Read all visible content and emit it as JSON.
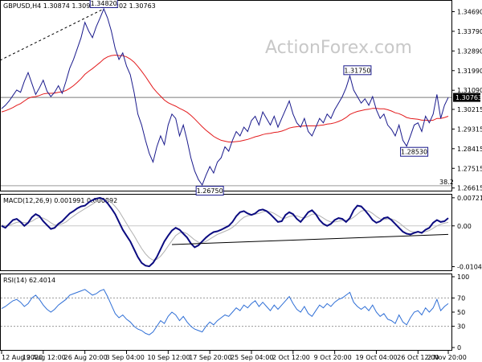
{
  "watermark": "ActionForex.com",
  "colors": {
    "price": "#1a1a8c",
    "ma": "#e31a1c",
    "macd_main": "#0b0b80",
    "macd_signal": "#b0b0b0",
    "rsi": "#2f6fd6",
    "ref_line": "#7a7a7a",
    "trend_line": "#000000",
    "frame": "#000000",
    "grid": "#cfcfcf"
  },
  "chart_data": [
    {
      "type": "line",
      "header": "GBPUSD,H4  1.30874 1.30957 1.30202 1.30763",
      "ylim": [
        1.2653,
        1.3515
      ],
      "yticks": [
        "1.34690",
        "1.33790",
        "1.32890",
        "1.31990",
        "1.31090",
        "1.30215",
        "1.29315",
        "1.28415",
        "1.27515",
        "1.26615"
      ],
      "current_price": "1.30763",
      "ref_level": 1.30763,
      "fib_label": "38.2",
      "fib_level": 1.2672,
      "annotations": [
        {
          "text": "1.34820",
          "x": 27,
          "y": 1.3482
        },
        {
          "text": "1.31750",
          "x": 94,
          "y": 1.3175
        },
        {
          "text": "1.26750",
          "x": 55,
          "y": 1.2675
        },
        {
          "text": "1.28530",
          "x": 109,
          "y": 1.2853
        }
      ],
      "series": [
        {
          "values": [
            1.3025,
            1.304,
            1.306,
            1.3085,
            1.311,
            1.31,
            1.315,
            1.319,
            1.314,
            1.309,
            1.312,
            1.3155,
            1.3105,
            1.308,
            1.31,
            1.313,
            1.3095,
            1.315,
            1.321,
            1.325,
            1.33,
            1.335,
            1.342,
            1.338,
            1.335,
            1.34,
            1.344,
            1.3482,
            1.344,
            1.338,
            1.33,
            1.325,
            1.328,
            1.322,
            1.318,
            1.31,
            1.3,
            1.295,
            1.288,
            1.282,
            1.278,
            1.285,
            1.29,
            1.286,
            1.295,
            1.3,
            1.298,
            1.29,
            1.295,
            1.288,
            1.28,
            1.274,
            1.27,
            1.2675,
            1.272,
            1.276,
            1.273,
            1.278,
            1.28,
            1.285,
            1.283,
            1.288,
            1.292,
            1.29,
            1.294,
            1.292,
            1.297,
            1.299,
            1.295,
            1.301,
            1.298,
            1.295,
            1.299,
            1.294,
            1.298,
            1.302,
            1.306,
            1.3,
            1.296,
            1.294,
            1.298,
            1.292,
            1.29,
            1.294,
            1.298,
            1.296,
            1.3,
            1.298,
            1.302,
            1.305,
            1.308,
            1.312,
            1.3175,
            1.311,
            1.308,
            1.305,
            1.307,
            1.304,
            1.308,
            1.302,
            1.298,
            1.3,
            1.295,
            1.293,
            1.29,
            1.295,
            1.288,
            1.2853,
            1.29,
            1.295,
            1.296,
            1.292,
            1.299,
            1.296,
            1.3,
            1.309,
            1.298,
            1.304,
            1.3076
          ]
        },
        {
          "values": [
            1.301,
            1.3015,
            1.3022,
            1.303,
            1.304,
            1.3048,
            1.306,
            1.3072,
            1.3078,
            1.308,
            1.3085,
            1.3092,
            1.3095,
            1.3095,
            1.3096,
            1.31,
            1.3102,
            1.3108,
            1.3118,
            1.313,
            1.3145,
            1.3162,
            1.3182,
            1.3196,
            1.3208,
            1.3222,
            1.3236,
            1.3252,
            1.3262,
            1.3268,
            1.327,
            1.3268,
            1.3268,
            1.3262,
            1.3252,
            1.3238,
            1.3218,
            1.3196,
            1.3172,
            1.3146,
            1.312,
            1.31,
            1.3082,
            1.3064,
            1.3052,
            1.3044,
            1.3036,
            1.3026,
            1.3018,
            1.3008,
            1.2994,
            1.2978,
            1.296,
            1.2942,
            1.2926,
            1.2912,
            1.2898,
            1.2888,
            1.288,
            1.2876,
            1.2872,
            1.2872,
            1.2874,
            1.2876,
            1.288,
            1.2884,
            1.289,
            1.2896,
            1.29,
            1.2906,
            1.291,
            1.2912,
            1.2916,
            1.2918,
            1.2922,
            1.2928,
            1.2936,
            1.294,
            1.2942,
            1.2944,
            1.2946,
            1.2946,
            1.2946,
            1.2946,
            1.2948,
            1.295,
            1.2954,
            1.2956,
            1.296,
            1.2966,
            1.2974,
            1.2984,
            1.2998,
            1.3006,
            1.3012,
            1.3016,
            1.302,
            1.3022,
            1.3026,
            1.3026,
            1.3024,
            1.3024,
            1.302,
            1.3014,
            1.3006,
            1.3002,
            1.2994,
            1.2984,
            1.298,
            1.2978,
            1.2976,
            1.2972,
            1.2972,
            1.297,
            1.2972,
            1.298,
            1.298,
            1.2984,
            1.299
          ]
        }
      ]
    },
    {
      "type": "line",
      "header": "MACD(12,26,9) 0.001991 0.000892",
      "ylim": [
        -0.0112,
        0.0078
      ],
      "yticks": [
        "0.007213",
        "0.00",
        "-0.01048"
      ],
      "ytick_values": [
        0.007213,
        0.0,
        -0.01048
      ],
      "zero_line": 0,
      "trendline": {
        "from": [
          45,
          -0.0048
        ],
        "to": [
          118,
          -0.0022
        ]
      },
      "series": [
        {
          "values": [
            0.0,
            -0.0005,
            0.0005,
            0.0015,
            0.0018,
            0.001,
            0.0,
            0.0008,
            0.0022,
            0.003,
            0.0025,
            0.0012,
            0.0002,
            -0.0008,
            -0.0005,
            0.0005,
            0.0012,
            0.0022,
            0.0032,
            0.0038,
            0.0045,
            0.005,
            0.0052,
            0.006,
            0.0066,
            0.007,
            0.0072,
            0.0068,
            0.0058,
            0.0045,
            0.003,
            0.001,
            -0.001,
            -0.0025,
            -0.004,
            -0.006,
            -0.008,
            -0.0095,
            -0.0102,
            -0.0104,
            -0.0095,
            -0.008,
            -0.006,
            -0.004,
            -0.0025,
            -0.0012,
            -0.0005,
            -0.001,
            -0.002,
            -0.003,
            -0.0045,
            -0.0055,
            -0.005,
            -0.004,
            -0.003,
            -0.0022,
            -0.0016,
            -0.0014,
            -0.001,
            -0.0005,
            0.0,
            0.001,
            0.0025,
            0.0035,
            0.0038,
            0.0032,
            0.0028,
            0.0032,
            0.004,
            0.0042,
            0.0038,
            0.003,
            0.002,
            0.001,
            0.0012,
            0.0028,
            0.0035,
            0.003,
            0.0018,
            0.001,
            0.0022,
            0.0035,
            0.004,
            0.003,
            0.0015,
            0.0005,
            0.0,
            0.0005,
            0.0015,
            0.002,
            0.0018,
            0.001,
            0.002,
            0.004,
            0.0052,
            0.005,
            0.004,
            0.0028,
            0.0015,
            0.0008,
            0.0012,
            0.002,
            0.0022,
            0.0015,
            0.0005,
            -0.0005,
            -0.0015,
            -0.002,
            -0.0022,
            -0.0018,
            -0.0015,
            -0.0018,
            -0.001,
            -0.0005,
            0.0008,
            0.0015,
            0.001,
            0.0012,
            0.002
          ]
        },
        {
          "values": [
            0.0002,
            0.0,
            0.0001,
            0.0005,
            0.0009,
            0.001,
            0.0008,
            0.0008,
            0.0012,
            0.0018,
            0.0022,
            0.002,
            0.0015,
            0.0008,
            0.0002,
            0.0002,
            0.0005,
            0.001,
            0.0018,
            0.0025,
            0.0032,
            0.0038,
            0.0044,
            0.005,
            0.0056,
            0.0062,
            0.0066,
            0.0068,
            0.0066,
            0.006,
            0.005,
            0.0038,
            0.0022,
            0.0006,
            -0.001,
            -0.0025,
            -0.0042,
            -0.0058,
            -0.0072,
            -0.0082,
            -0.0088,
            -0.0086,
            -0.0078,
            -0.0066,
            -0.0052,
            -0.0038,
            -0.0025,
            -0.0018,
            -0.0016,
            -0.002,
            -0.0028,
            -0.0036,
            -0.0042,
            -0.0044,
            -0.004,
            -0.0034,
            -0.0028,
            -0.0022,
            -0.0018,
            -0.0014,
            -0.001,
            -0.0004,
            0.0004,
            0.0014,
            0.0022,
            0.0026,
            0.0028,
            0.003,
            0.0032,
            0.0036,
            0.0038,
            0.0036,
            0.0032,
            0.0026,
            0.002,
            0.002,
            0.0024,
            0.0026,
            0.0026,
            0.0022,
            0.002,
            0.0024,
            0.003,
            0.003,
            0.0026,
            0.002,
            0.0014,
            0.001,
            0.001,
            0.0012,
            0.0014,
            0.0014,
            0.0016,
            0.0022,
            0.003,
            0.0038,
            0.004,
            0.0038,
            0.0032,
            0.0024,
            0.0018,
            0.0016,
            0.0018,
            0.0018,
            0.0014,
            0.0008,
            0.0,
            -0.0008,
            -0.0014,
            -0.0016,
            -0.0016,
            -0.0016,
            -0.0015,
            -0.0012,
            -0.0006,
            0.0,
            0.0004,
            0.0007,
            0.0009
          ]
        }
      ]
    },
    {
      "type": "line",
      "header": "RSI(14) 62.4014",
      "ylim": [
        0,
        100
      ],
      "yticks": [
        "100",
        "70",
        "50",
        "30",
        "0"
      ],
      "ytick_values": [
        100,
        70,
        50,
        30,
        0
      ],
      "levels": [
        70,
        30
      ],
      "series": [
        {
          "values": [
            55,
            58,
            62,
            66,
            68,
            64,
            58,
            62,
            70,
            74,
            68,
            60,
            54,
            50,
            54,
            60,
            64,
            68,
            74,
            76,
            78,
            80,
            82,
            78,
            74,
            76,
            80,
            82,
            72,
            60,
            48,
            42,
            46,
            40,
            36,
            30,
            26,
            24,
            20,
            18,
            22,
            30,
            38,
            34,
            44,
            50,
            46,
            38,
            44,
            36,
            30,
            26,
            24,
            22,
            30,
            36,
            32,
            38,
            42,
            46,
            44,
            50,
            56,
            52,
            60,
            56,
            62,
            66,
            58,
            64,
            58,
            52,
            60,
            54,
            60,
            66,
            72,
            62,
            54,
            50,
            58,
            48,
            44,
            52,
            60,
            56,
            62,
            58,
            64,
            68,
            70,
            74,
            78,
            64,
            58,
            54,
            58,
            52,
            60,
            50,
            44,
            48,
            40,
            38,
            34,
            46,
            36,
            32,
            42,
            50,
            52,
            46,
            56,
            50,
            56,
            68,
            52,
            58,
            62
          ]
        }
      ]
    }
  ],
  "x_axis": {
    "labels": [
      "12 Aug 2020",
      "19 Aug 12:00",
      "26 Aug 20:00",
      "3 Sep 04:00",
      "10 Sep 12:00",
      "17 Sep 20:00",
      "25 Sep 04:00",
      "2 Oct 12:00",
      "9 Oct 20:00",
      "19 Oct 04:00",
      "26 Oct 12:00",
      "2 Nov 20:00"
    ],
    "label_index": [
      0,
      11,
      22,
      33,
      44,
      55,
      66,
      77,
      88,
      99,
      110,
      121
    ]
  }
}
